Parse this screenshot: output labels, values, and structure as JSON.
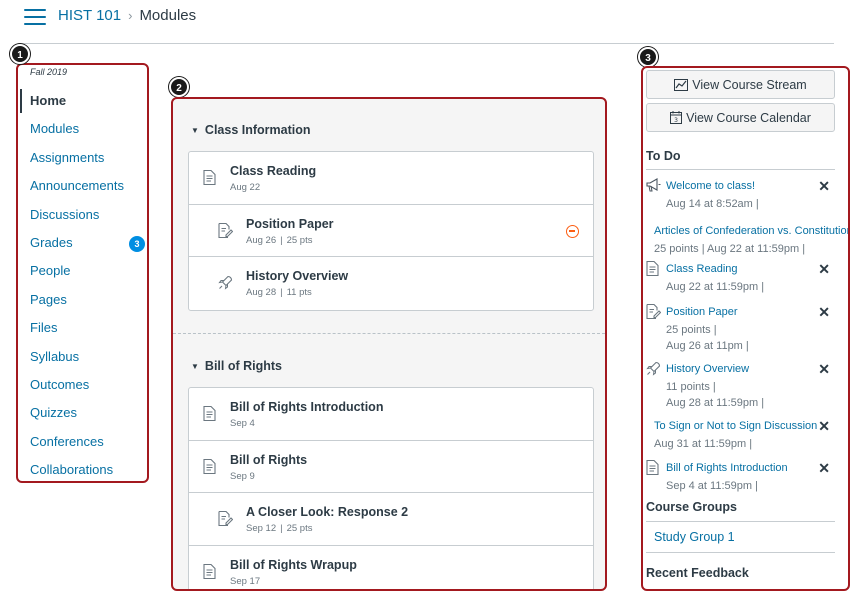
{
  "header": {
    "course": "HIST 101",
    "separator": "›",
    "page": "Modules"
  },
  "callouts": [
    "1",
    "2",
    "3"
  ],
  "nav": {
    "term": "Fall 2019",
    "items": [
      {
        "label": "Home",
        "active": true
      },
      {
        "label": "Modules"
      },
      {
        "label": "Assignments"
      },
      {
        "label": "Announcements"
      },
      {
        "label": "Discussions"
      },
      {
        "label": "Grades",
        "badge": "3"
      },
      {
        "label": "People"
      },
      {
        "label": "Pages"
      },
      {
        "label": "Files"
      },
      {
        "label": "Syllabus"
      },
      {
        "label": "Outcomes"
      },
      {
        "label": "Quizzes"
      },
      {
        "label": "Conferences"
      },
      {
        "label": "Collaborations"
      }
    ]
  },
  "modules": [
    {
      "title": "Class Information",
      "items": [
        {
          "title": "Class Reading",
          "icon": "page-icon",
          "date": "Aug 22",
          "points": ""
        },
        {
          "title": "Position Paper",
          "icon": "assignment-icon",
          "date": "Aug 26",
          "points": "25 pts",
          "unpublished": true
        },
        {
          "title": "History Overview",
          "icon": "quiz-icon",
          "date": "Aug 28",
          "points": "11 pts"
        }
      ]
    },
    {
      "title": "Bill of Rights",
      "items": [
        {
          "title": "Bill of Rights Introduction",
          "icon": "page-icon",
          "date": "Sep 4",
          "points": ""
        },
        {
          "title": "Bill of Rights",
          "icon": "page-icon",
          "date": "Sep 9",
          "points": ""
        },
        {
          "title": "A Closer Look: Response 2",
          "icon": "assignment-icon",
          "date": "Sep 12",
          "points": "25 pts"
        },
        {
          "title": "Bill of Rights Wrapup",
          "icon": "page-icon",
          "date": "Sep 17",
          "points": ""
        }
      ]
    }
  ],
  "sidebar": {
    "stream_button": "View Course Stream",
    "calendar_button": "View Course Calendar",
    "todo_heading": "To Do",
    "todo": [
      {
        "title": "Welcome to class!",
        "icon": "announcement-icon",
        "lines": [
          "Aug 14 at 8:52am  |"
        ],
        "dismiss": true
      },
      {
        "title": "Articles of Confederation vs. Constitution",
        "icon": "",
        "lines": [
          "25 points  |  Aug 22 at 11:59pm  |"
        ],
        "dismiss": false
      },
      {
        "title": "Class Reading",
        "icon": "page-icon",
        "lines": [
          "Aug 22 at 11:59pm  |"
        ],
        "dismiss": true
      },
      {
        "title": "Position Paper",
        "icon": "assignment-icon",
        "lines": [
          "25 points  |",
          "Aug 26 at 11pm  |"
        ],
        "dismiss": true
      },
      {
        "title": "History Overview",
        "icon": "quiz-icon",
        "lines": [
          "11 points  |",
          "Aug 28 at 11:59pm  |"
        ],
        "dismiss": true
      },
      {
        "title": "To Sign or Not to Sign Discussion",
        "icon": "",
        "lines": [
          "Aug 31 at 11:59pm  |"
        ],
        "dismiss": true
      },
      {
        "title": "Bill of Rights Introduction",
        "icon": "page-icon",
        "lines": [
          "Sep 4 at 11:59pm  |"
        ],
        "dismiss": true
      }
    ],
    "dismiss_symbol": "✕",
    "groups_heading": "Course Groups",
    "group": "Study Group 1",
    "feedback_heading": "Recent Feedback"
  }
}
